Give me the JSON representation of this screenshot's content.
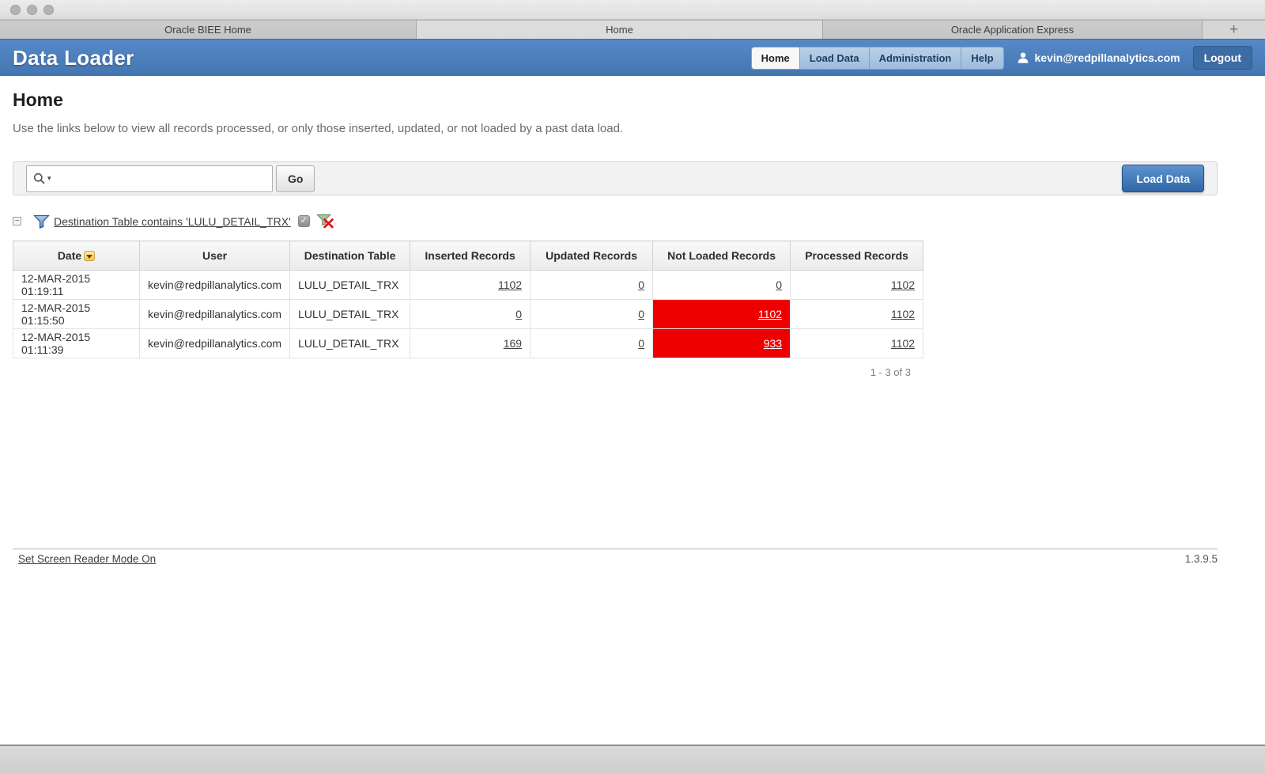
{
  "window": {
    "tabs": [
      {
        "label": "Oracle BIEE Home",
        "active": false
      },
      {
        "label": "Home",
        "active": true
      },
      {
        "label": "Oracle Application Express",
        "active": false
      }
    ],
    "new_tab_glyph": "+"
  },
  "header": {
    "app_title": "Data Loader",
    "nav": [
      {
        "label": "Home",
        "active": true
      },
      {
        "label": "Load Data",
        "active": false
      },
      {
        "label": "Administration",
        "active": false
      },
      {
        "label": "Help",
        "active": false
      }
    ],
    "user_email": "kevin@redpillanalytics.com",
    "logout_label": "Logout"
  },
  "page": {
    "title": "Home",
    "description": "Use the links below to view all records processed, or only those inserted, updated, or not loaded by a past data load."
  },
  "toolbar": {
    "search_value": "",
    "search_placeholder": "",
    "go_label": "Go",
    "load_data_label": "Load Data"
  },
  "filter": {
    "collapse_glyph": "−",
    "label": "Destination Table contains 'LULU_DETAIL_TRX'",
    "enabled": true,
    "checkbox_glyph": "✓"
  },
  "table": {
    "columns": [
      "Date",
      "User",
      "Destination Table",
      "Inserted Records",
      "Updated Records",
      "Not Loaded Records",
      "Processed Records"
    ],
    "rows": [
      {
        "date": "12-MAR-2015 01:19:11",
        "user": "kevin@redpillanalytics.com",
        "destination_table": "LULU_DETAIL_TRX",
        "inserted": "1102",
        "updated": "0",
        "not_loaded": "0",
        "not_loaded_alert": false,
        "processed": "1102"
      },
      {
        "date": "12-MAR-2015 01:15:50",
        "user": "kevin@redpillanalytics.com",
        "destination_table": "LULU_DETAIL_TRX",
        "inserted": "0",
        "updated": "0",
        "not_loaded": "1102",
        "not_loaded_alert": true,
        "processed": "1102"
      },
      {
        "date": "12-MAR-2015 01:11:39",
        "user": "kevin@redpillanalytics.com",
        "destination_table": "LULU_DETAIL_TRX",
        "inserted": "169",
        "updated": "0",
        "not_loaded": "933",
        "not_loaded_alert": true,
        "processed": "1102"
      }
    ],
    "pagination": "1 - 3 of 3"
  },
  "footer": {
    "screen_reader_link": "Set Screen Reader Mode On",
    "version": "1.3.9.5"
  },
  "colors": {
    "header_blue": "#4d81bd",
    "nav_inactive_blue": "#a9c3e1",
    "load_data_blue": "#3f74b2",
    "alert_red": "#ee0000",
    "sort_icon_yellow": "#f7cd56"
  }
}
